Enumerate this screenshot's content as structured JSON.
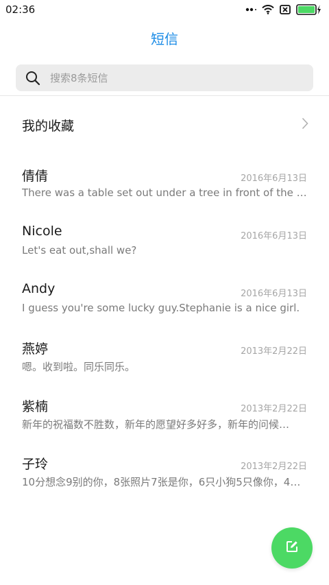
{
  "status_bar": {
    "time": "02:36"
  },
  "header": {
    "title": "短信"
  },
  "search": {
    "placeholder": "搜索8条短信"
  },
  "favorites": {
    "label": "我的收藏"
  },
  "conversations": [
    {
      "name": "倩倩",
      "date": "2016年6月13日",
      "preview": "There was a table set out under a tree in front of the ho…"
    },
    {
      "name": "Nicole",
      "date": "2016年6月13日",
      "preview": "Let's eat out,shall we?"
    },
    {
      "name": "Andy",
      "date": "2016年6月13日",
      "preview": "I guess you're some lucky guy.Stephanie is a nice girl."
    },
    {
      "name": "燕婷",
      "date": "2013年2月22日",
      "preview": "嗯。收到啦。同乐同乐。"
    },
    {
      "name": "紫楠",
      "date": "2013年2月22日",
      "preview": "新年的祝福数不胜数，新年的愿望好多好多，新年的问候…"
    },
    {
      "name": "子玲",
      "date": "2013年2月22日",
      "preview": "10分想念9别的你，8张照片7张是你，6只小狗5只像你，4…"
    }
  ],
  "icons": {
    "search": "search-icon",
    "chevron": "chevron-right-icon",
    "compose": "compose-icon",
    "wifi": "wifi-icon",
    "sim": "no-sim-icon",
    "battery": "battery-charging-icon"
  },
  "colors": {
    "accent": "#1a8be6",
    "fab": "#4cd964",
    "battery": "#4cd964"
  }
}
